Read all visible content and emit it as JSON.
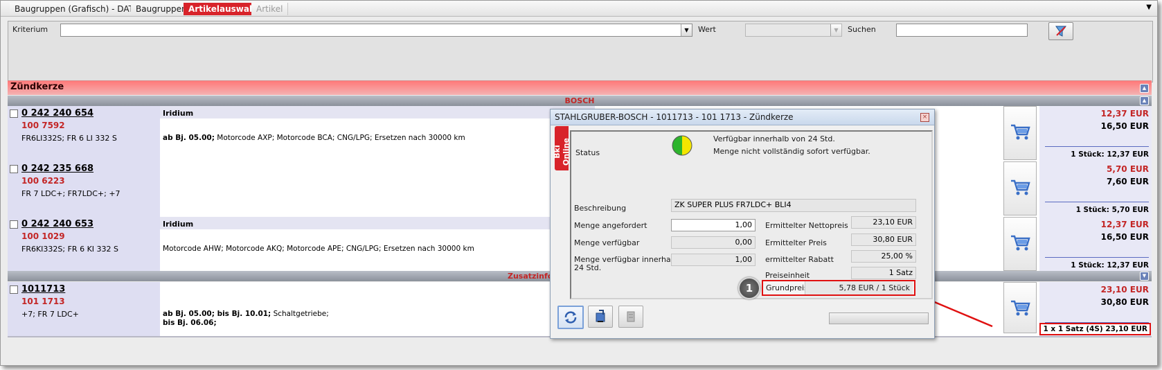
{
  "tabs": [
    {
      "label": "Baugruppen (Grafisch)  - DAT"
    },
    {
      "label": "Baugruppen"
    },
    {
      "label": "Artikelauswahl"
    },
    {
      "label": "Artikel"
    }
  ],
  "tab_overflow_icon": "chevron-down-icon",
  "filter": {
    "kriterium_label": "Kriterium",
    "kriterium_value": "",
    "wert_label": "Wert",
    "wert_value": "",
    "suchen_label": "Suchen",
    "suchen_value": "",
    "filter_icon": "filter-icon"
  },
  "section_title": "Zündkerze",
  "groups": {
    "bosch": "BOSCH",
    "zusatz": "Zusatzinformation STAHLGRUBER"
  },
  "articles": [
    {
      "number": "0 242 240 654",
      "sub": "100 7592",
      "alias": "FR6LI332S; FR 6 LI 332 S",
      "head": "Iridium",
      "desc_bold": "ab Bj. 05.00;",
      "desc": " Motorcode AXP; Motorcode BCA; CNG/LPG; Ersetzen nach 30000 km",
      "price_red": "12,37 EUR",
      "price": "16,50 EUR",
      "unit_price": "1 Stück: 12,37 EUR"
    },
    {
      "number": "0 242 235 668",
      "sub": "100 6223",
      "alias": "FR 7 LDC+; FR7LDC+; +7",
      "head": "",
      "desc_bold": "",
      "desc": "",
      "price_red": "5,70 EUR",
      "price": "7,60 EUR",
      "unit_price": "1 Stück: 5,70 EUR"
    },
    {
      "number": "0 242 240 653",
      "sub": "100 1029",
      "alias": "FR6KI332S; FR 6 KI 332 S",
      "head": "Iridium",
      "desc_bold": "",
      "desc": "Motorcode AHW; Motorcode AKQ; Motorcode APE; CNG/LPG; Ersetzen nach 30000 km",
      "price_red": "12,37 EUR",
      "price": "16,50 EUR",
      "unit_price": "1 Stück: 12,37 EUR"
    },
    {
      "number": "1011713",
      "sub": "101 1713",
      "alias": "+7; FR 7 LDC+",
      "head": "",
      "desc_bold": "ab Bj. 05.00; bis Bj. 10.01;",
      "desc": " Schaltgetriebe;",
      "desc2": "bis Bj. 06.06;",
      "price_red": "23,10 EUR",
      "price": "30,80 EUR",
      "unit_price": "1 x 1 Satz (4S) 23,10 EUR"
    }
  ],
  "dialog": {
    "title": "STAHLGRUBER-BOSCH - 1011713 - 101 1713 - Zündkerze",
    "vertical_tab": "Bki Online",
    "status_label": "Status",
    "status_line1": "Verfügbar innerhalb von 24 Std.",
    "status_line2": "Menge nicht vollständig sofort verfügbar.",
    "status_colors": {
      "left": "#2db42d",
      "right": "#f4e600"
    },
    "beschreibung_label": "Beschreibung",
    "beschreibung_value": "ZK SUPER PLUS FR7LDC+ BLI4",
    "menge_angefordert_label": "Menge angefordert",
    "menge_angefordert_value": "1,00",
    "menge_verfuegbar_label": "Menge verfügbar",
    "menge_verfuegbar_value": "0,00",
    "menge_24_label_1": "Menge verfügbar innerhalb",
    "menge_24_label_2": "24 Std.",
    "menge_24_value": "1,00",
    "netto_label": "Ermittelter Nettopreis",
    "netto_value": "23,10 EUR",
    "preis_label": "Ermittelter Preis",
    "preis_value": "30,80 EUR",
    "rabatt_label": "ermittelter Rabatt",
    "rabatt_value": "25,00 %",
    "preiseinheit_label": "Preiseinheit",
    "preiseinheit_value": "1 Satz",
    "grundpreis_label": "Grundpreis",
    "grundpreis_value": "5,78 EUR / 1 Stück",
    "callout_number": "1"
  },
  "colors": {
    "accent_red": "#d8232a",
    "highlight_red": "#e01010",
    "price_red": "#c32626"
  }
}
